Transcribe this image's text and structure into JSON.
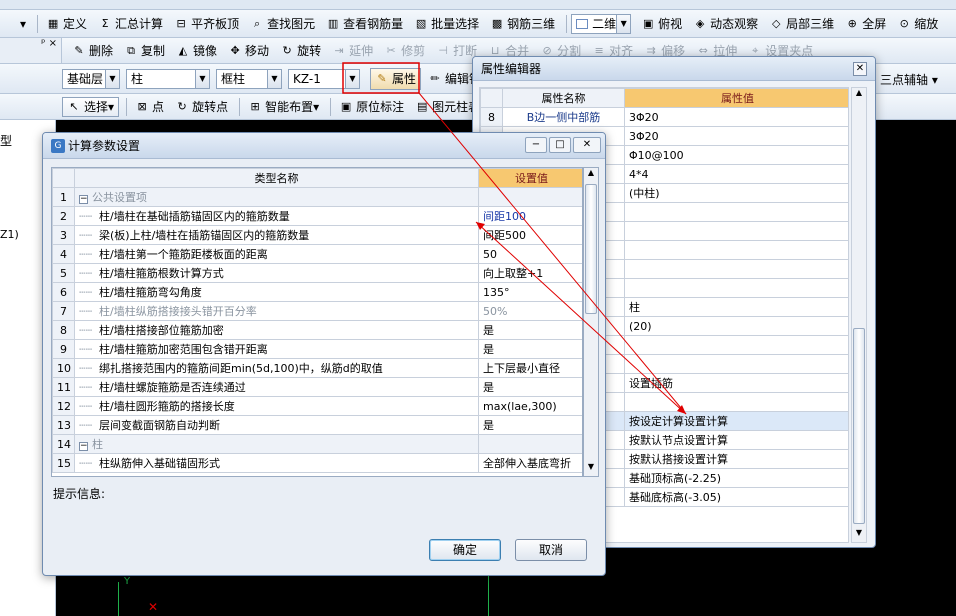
{
  "toolbar_row1": {
    "items": [
      {
        "label": "定义",
        "icon": "definition-icon"
      },
      {
        "label": "汇总计算",
        "icon": "sigma-icon"
      },
      {
        "label": "平齐板顶",
        "icon": "align-top-icon"
      },
      {
        "label": "查找图元",
        "icon": "find-icon"
      },
      {
        "label": "查看钢筋量",
        "icon": "view-rebar-icon"
      },
      {
        "label": "批量选择",
        "icon": "batch-select-icon"
      },
      {
        "label": "钢筋三维",
        "icon": "rebar-3d-icon"
      }
    ],
    "view_combo": "二维",
    "right_items": [
      {
        "label": "俯视",
        "icon": "top-view-icon"
      },
      {
        "label": "动态观察",
        "icon": "orbit-icon"
      },
      {
        "label": "局部三维",
        "icon": "local-3d-icon"
      },
      {
        "label": "全屏",
        "icon": "fullscreen-icon"
      },
      {
        "label": "缩放",
        "icon": "zoom-icon"
      }
    ]
  },
  "toolbar_row2": {
    "items": [
      {
        "label": "删除",
        "icon": "delete-icon",
        "enabled": true
      },
      {
        "label": "复制",
        "icon": "copy-icon",
        "enabled": true
      },
      {
        "label": "镜像",
        "icon": "mirror-icon",
        "enabled": true
      },
      {
        "label": "移动",
        "icon": "move-icon",
        "enabled": true
      },
      {
        "label": "旋转",
        "icon": "rotate-icon",
        "enabled": true
      },
      {
        "label": "延伸",
        "icon": "extend-icon",
        "enabled": false
      },
      {
        "label": "修剪",
        "icon": "trim-icon",
        "enabled": false
      },
      {
        "label": "打断",
        "icon": "break-icon",
        "enabled": false
      },
      {
        "label": "合并",
        "icon": "merge-icon",
        "enabled": false
      },
      {
        "label": "分割",
        "icon": "split-icon",
        "enabled": false
      },
      {
        "label": "对齐",
        "icon": "align-icon",
        "enabled": false
      },
      {
        "label": "偏移",
        "icon": "offset-icon",
        "enabled": false
      },
      {
        "label": "拉伸",
        "icon": "stretch-icon",
        "enabled": false
      },
      {
        "label": "设置夹点",
        "icon": "grip-icon",
        "enabled": false
      }
    ]
  },
  "toolbar_row3": {
    "floor": "基础层",
    "category": "柱",
    "type": "框柱",
    "name": "KZ-1",
    "property_label": "属性",
    "edit_rebar_label": "编辑钢筋",
    "three_point_label": "三点辅轴"
  },
  "toolbar_row4": {
    "select_label": "选择",
    "point_label": "点",
    "rotate_point_label": "旋转点",
    "smart_layout_label": "智能布置",
    "original_mark_label": "原位标注",
    "element_table_label": "图元柱表"
  },
  "left_panel": {
    "fragments": [
      "型",
      "Z1)"
    ]
  },
  "property_editor": {
    "title": "属性编辑器",
    "col_name": "属性名称",
    "col_value": "属性值",
    "rows": [
      {
        "num": "8",
        "name": "B边一侧中部筋",
        "value": "3Φ20"
      },
      {
        "num": "",
        "name": "",
        "value": "3Φ20"
      },
      {
        "num": "",
        "name": "",
        "value": "Φ10@100"
      },
      {
        "num": "",
        "name": "",
        "value": "4*4"
      },
      {
        "num": "",
        "name": "",
        "value": "(中柱)"
      },
      {
        "num": "",
        "name": "",
        "value": ""
      },
      {
        "num": "",
        "name": "",
        "value": ""
      },
      {
        "num": "",
        "name": "",
        "value": ""
      },
      {
        "num": "",
        "name": "",
        "value": ""
      },
      {
        "num": "",
        "name": "",
        "value": ""
      },
      {
        "num": "",
        "name": "",
        "value": "柱"
      },
      {
        "num": "",
        "name": "",
        "value": "(20)"
      },
      {
        "num": "",
        "name": "",
        "value": ""
      },
      {
        "num": "",
        "name": "",
        "value": ""
      },
      {
        "num": "",
        "name": "",
        "value": "设置插筋"
      },
      {
        "num": "",
        "name": "",
        "value": ""
      },
      {
        "num": "",
        "name": "",
        "value": "按设定计算设置计算"
      },
      {
        "num": "",
        "name": "",
        "value": "按默认节点设置计算"
      },
      {
        "num": "",
        "name": "",
        "value": "按默认搭接设置计算"
      },
      {
        "num": "",
        "name": "",
        "value": "基础顶标高(-2.25)"
      },
      {
        "num": "",
        "name": "",
        "value": "基础底标高(-3.05)"
      }
    ]
  },
  "calc_dialog": {
    "title": "计算参数设置",
    "col_name": "类型名称",
    "col_value": "设置值",
    "rows": [
      {
        "num": "1",
        "group": true,
        "name": "公共设置项",
        "value": ""
      },
      {
        "num": "2",
        "group": false,
        "name": "柱/墙柱在基础插筋锚固区内的箍筋数量",
        "value": "间距100"
      },
      {
        "num": "3",
        "group": false,
        "name": "梁(板)上柱/墙柱在插筋锚固区内的箍筋数量",
        "value": "间距500"
      },
      {
        "num": "4",
        "group": false,
        "name": "柱/墙柱第一个箍筋距楼板面的距离",
        "value": "50"
      },
      {
        "num": "5",
        "group": false,
        "name": "柱/墙柱箍筋根数计算方式",
        "value": "向上取整+1"
      },
      {
        "num": "6",
        "group": false,
        "name": "柱/墙柱箍筋弯勾角度",
        "value": "135°"
      },
      {
        "num": "7",
        "group": false,
        "name": "柱/墙柱纵筋搭接接头错开百分率",
        "value": "50%",
        "disabled": true
      },
      {
        "num": "8",
        "group": false,
        "name": "柱/墙柱搭接部位箍筋加密",
        "value": "是"
      },
      {
        "num": "9",
        "group": false,
        "name": "柱/墙柱箍筋加密范围包含错开距离",
        "value": "是"
      },
      {
        "num": "10",
        "group": false,
        "name": "绑扎搭接范围内的箍筋间距min(5d,100)中，纵筋d的取值",
        "value": "上下层最小直径"
      },
      {
        "num": "11",
        "group": false,
        "name": "柱/墙柱螺旋箍筋是否连续通过",
        "value": "是"
      },
      {
        "num": "12",
        "group": false,
        "name": "柱/墙柱圆形箍筋的搭接长度",
        "value": "max(lae,300)"
      },
      {
        "num": "13",
        "group": false,
        "name": "层间变截面钢筋自动判断",
        "value": "是"
      },
      {
        "num": "14",
        "group": true,
        "name": "柱",
        "value": ""
      },
      {
        "num": "15",
        "group": false,
        "name": "柱纵筋伸入基础锚固形式",
        "value": "全部伸入基底弯折"
      }
    ],
    "hint_label": "提示信息:",
    "ok_label": "确定",
    "cancel_label": "取消"
  },
  "colors": {
    "header_value_bg": "#f7c870",
    "selected_row": "#dbe8f8",
    "canvas": "#000000",
    "annotation_red": "#e00000"
  }
}
